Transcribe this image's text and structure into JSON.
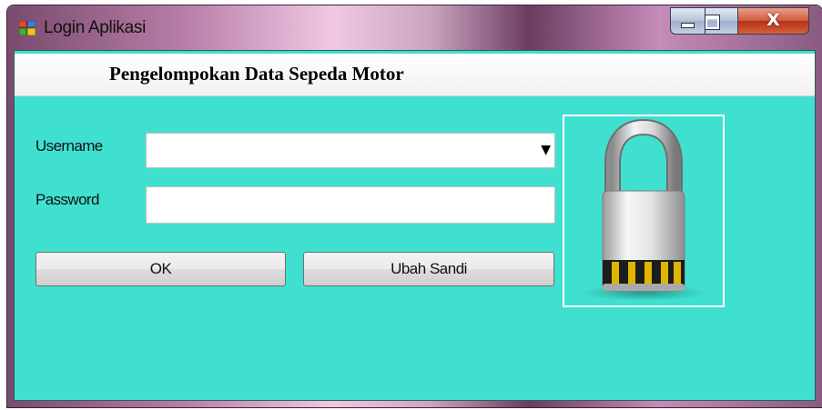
{
  "window": {
    "title": "Login Aplikasi",
    "app_icon": "windows-form-icon",
    "controls": {
      "minimize_icon": "minimize-icon",
      "maximize_icon": "maximize-icon",
      "close_icon": "close-icon",
      "close_glyph": "X"
    }
  },
  "header": {
    "title": "Pengelompokan Data Sepeda Motor"
  },
  "form": {
    "username_label": "Username",
    "username_value": "",
    "dropdown_arrow": "▼",
    "password_label": "Password",
    "password_value": "",
    "ok_button": "OK",
    "change_password_button": "Ubah Sandi"
  },
  "image": {
    "icon": "padlock-icon"
  },
  "colors": {
    "client_background": "#40e0d0",
    "header_background": "#ffffff",
    "close_button": "#c44a2c"
  }
}
